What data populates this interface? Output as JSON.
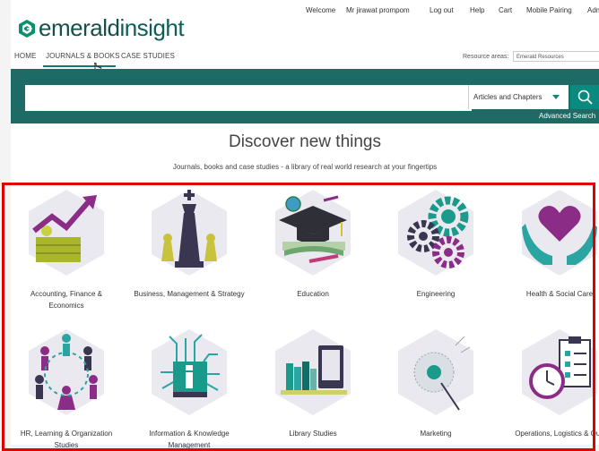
{
  "topbar": {
    "welcome": "Welcome",
    "user": "Mr jirawat prompom",
    "logout": "Log out",
    "help": "Help",
    "cart": "Cart",
    "mobile_pairing": "Mobile Pairing",
    "admin": "Adm"
  },
  "logo": {
    "part1": "emerald",
    "part2": "insight"
  },
  "nav": {
    "home": "HOME",
    "journals_books": "JOURNALS & BOOKS",
    "case_studies": "CASE STUDIES"
  },
  "resource": {
    "label": "Resource areas:",
    "value": "Emerald Resources"
  },
  "search": {
    "placeholder": "",
    "type_value": "Articles and Chapters",
    "advanced": "Advanced Search"
  },
  "hero": {
    "title": "Discover new things",
    "subtitle": "Journals, books and case studies - a library of real world research at your fingertips"
  },
  "categories": [
    {
      "label_line1": "Accounting, Finance &",
      "label_line2": "Economics"
    },
    {
      "label_line1": "Business, Management & Strategy",
      "label_line2": ""
    },
    {
      "label_line1": "Education",
      "label_line2": ""
    },
    {
      "label_line1": "Engineering",
      "label_line2": ""
    },
    {
      "label_line1": "Health & Social Care",
      "label_line2": ""
    },
    {
      "label_line1": "HR, Learning & Organization",
      "label_line2": "Studies"
    },
    {
      "label_line1": "Information & Knowledge",
      "label_line2": "Management"
    },
    {
      "label_line1": "Library Studies",
      "label_line2": ""
    },
    {
      "label_line1": "Marketing",
      "label_line2": ""
    },
    {
      "label_line1": "Operations, Logistics & Qua",
      "label_line2": ""
    }
  ],
  "colors": {
    "brand_teal": "#1e6a64",
    "accent_green": "#0a8a7e",
    "highlight_red": "#e00000"
  }
}
